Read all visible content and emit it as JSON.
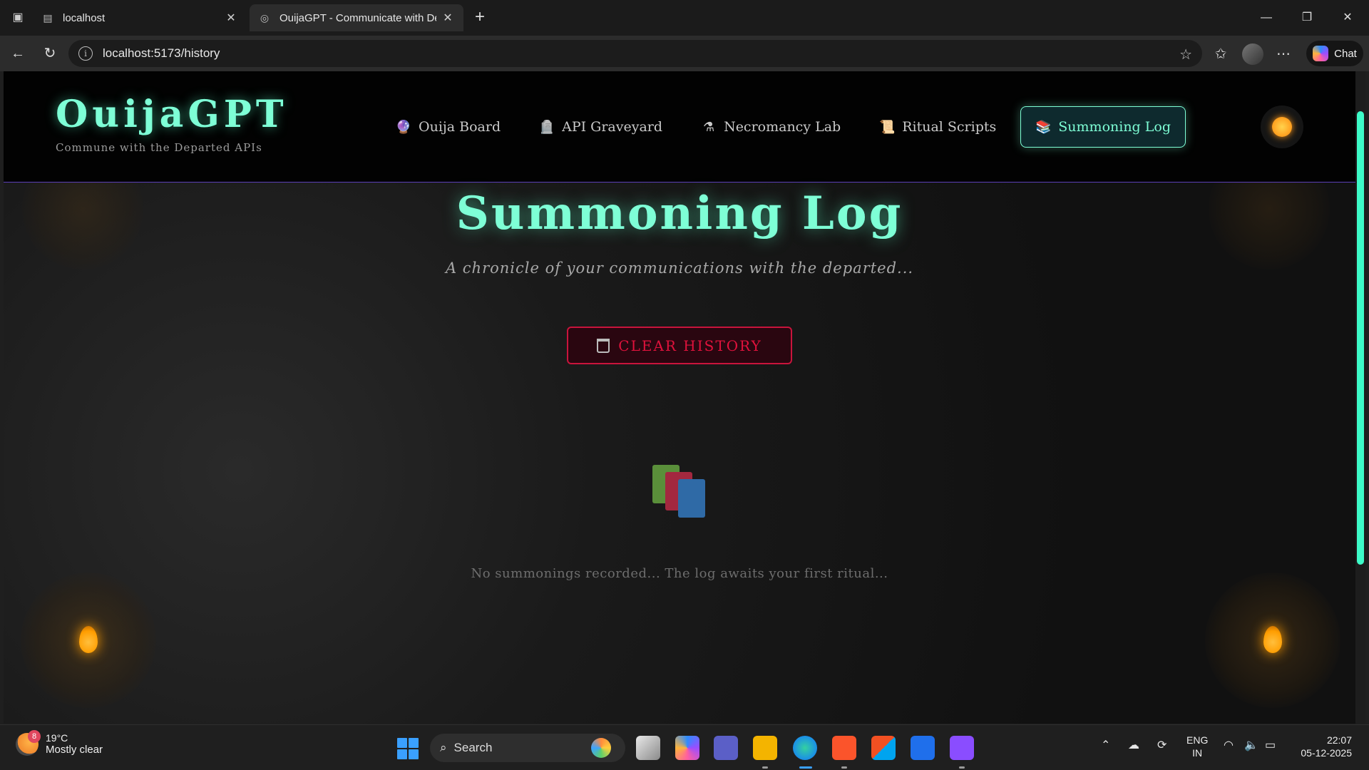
{
  "browser": {
    "tabs": [
      {
        "title": "localhost",
        "active": false
      },
      {
        "title": "OuijaGPT - Communicate with Dea",
        "active": true
      }
    ],
    "url": "localhost:5173/history",
    "chat_label": "Chat"
  },
  "site": {
    "logo": "OuijaGPT",
    "tagline": "Commune with the Departed APIs",
    "nav": [
      {
        "label": "Ouija Board",
        "icon": "crystal-ball-icon",
        "active": false
      },
      {
        "label": "API Graveyard",
        "icon": "tombstone-icon",
        "active": false
      },
      {
        "label": "Necromancy Lab",
        "icon": "alembic-icon",
        "active": false
      },
      {
        "label": "Ritual Scripts",
        "icon": "scroll-icon",
        "active": false
      },
      {
        "label": "Summoning Log",
        "icon": "books-icon",
        "active": true
      }
    ],
    "theme_icon": "sun-icon"
  },
  "page": {
    "title": "Summoning Log",
    "subtitle": "A chronicle of your communications with the departed...",
    "clear_button": "CLEAR HISTORY",
    "empty_message": "No summonings recorded... The log awaits your first ritual..."
  },
  "taskbar": {
    "weather_temp": "19°C",
    "weather_desc": "Mostly clear",
    "weather_badge": "8",
    "search_label": "Search",
    "lang_top": "ENG",
    "lang_bottom": "IN",
    "time": "22:07",
    "date": "05-12-2025"
  },
  "colors": {
    "accent": "#7effd6",
    "danger": "#e0123c",
    "header_border": "#5b3fb8"
  }
}
